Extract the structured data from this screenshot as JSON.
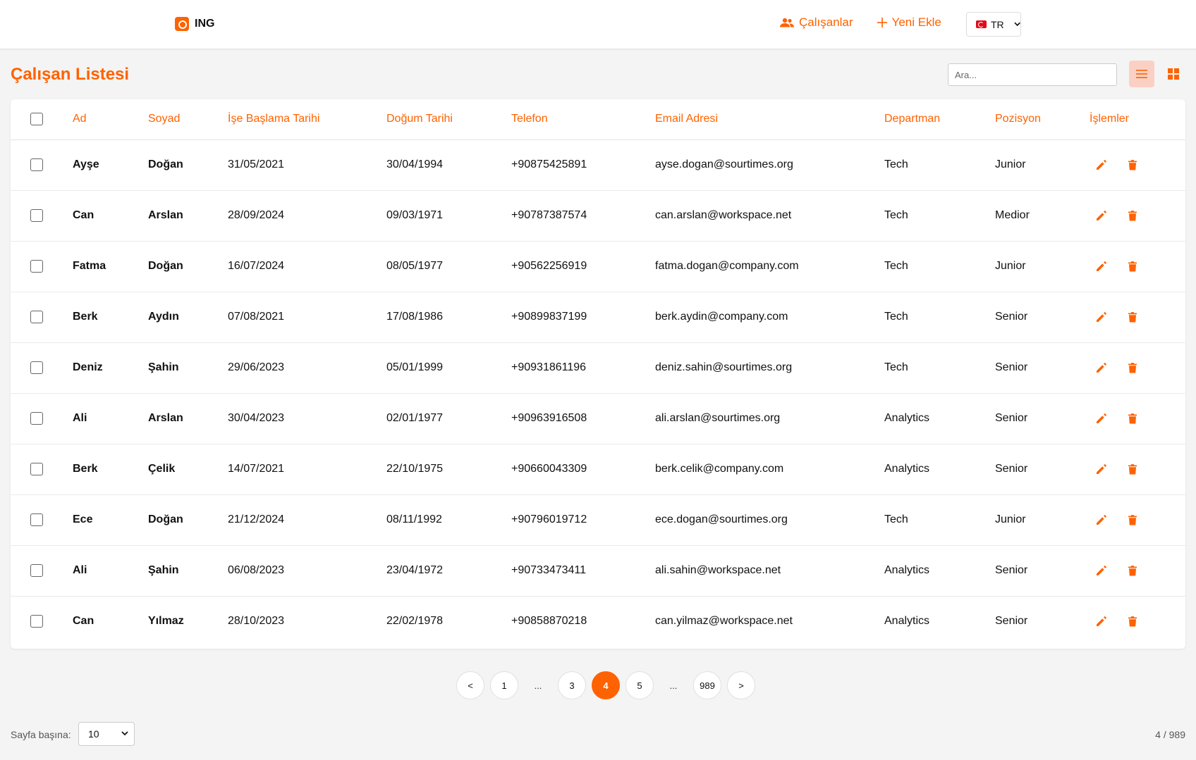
{
  "header": {
    "brand": "ING",
    "nav": {
      "employees": "Çalışanlar",
      "add_new": "Yeni Ekle"
    },
    "language": "TR"
  },
  "page": {
    "title": "Çalışan Listesi",
    "search_placeholder": "Ara..."
  },
  "table": {
    "columns": [
      "Ad",
      "Soyad",
      "İşe Başlama Tarihi",
      "Doğum Tarihi",
      "Telefon",
      "Email Adresi",
      "Departman",
      "Pozisyon",
      "İşlemler"
    ],
    "rows": [
      [
        "Ayşe",
        "Doğan",
        "31/05/2021",
        "30/04/1994",
        "+90875425891",
        "ayse.dogan@sourtimes.org",
        "Tech",
        "Junior"
      ],
      [
        "Can",
        "Arslan",
        "28/09/2024",
        "09/03/1971",
        "+90787387574",
        "can.arslan@workspace.net",
        "Tech",
        "Medior"
      ],
      [
        "Fatma",
        "Doğan",
        "16/07/2024",
        "08/05/1977",
        "+90562256919",
        "fatma.dogan@company.com",
        "Tech",
        "Junior"
      ],
      [
        "Berk",
        "Aydın",
        "07/08/2021",
        "17/08/1986",
        "+90899837199",
        "berk.aydin@company.com",
        "Tech",
        "Senior"
      ],
      [
        "Deniz",
        "Şahin",
        "29/06/2023",
        "05/01/1999",
        "+90931861196",
        "deniz.sahin@sourtimes.org",
        "Tech",
        "Senior"
      ],
      [
        "Ali",
        "Arslan",
        "30/04/2023",
        "02/01/1977",
        "+90963916508",
        "ali.arslan@sourtimes.org",
        "Analytics",
        "Senior"
      ],
      [
        "Berk",
        "Çelik",
        "14/07/2021",
        "22/10/1975",
        "+90660043309",
        "berk.celik@company.com",
        "Analytics",
        "Senior"
      ],
      [
        "Ece",
        "Doğan",
        "21/12/2024",
        "08/11/1992",
        "+90796019712",
        "ece.dogan@sourtimes.org",
        "Tech",
        "Junior"
      ],
      [
        "Ali",
        "Şahin",
        "06/08/2023",
        "23/04/1972",
        "+90733473411",
        "ali.sahin@workspace.net",
        "Analytics",
        "Senior"
      ],
      [
        "Can",
        "Yılmaz",
        "28/10/2023",
        "22/02/1978",
        "+90858870218",
        "can.yilmaz@workspace.net",
        "Analytics",
        "Senior"
      ]
    ]
  },
  "pagination": {
    "prev": "<",
    "next": ">",
    "dots": "...",
    "pages": [
      "1",
      "3",
      "4",
      "5",
      "989"
    ],
    "current": "4"
  },
  "footer": {
    "per_page_label": "Sayfa başına:",
    "per_page_value": "10",
    "page_info": "4 / 989"
  },
  "colors": {
    "accent": "#ff6200",
    "active_view_bg": "#fbd0c4"
  },
  "icons": {
    "nav_employees": "people-icon",
    "nav_add": "plus-icon",
    "view_list": "list-icon",
    "view_grid": "grid-icon",
    "row_edit": "pencil-icon",
    "row_delete": "trash-icon"
  }
}
